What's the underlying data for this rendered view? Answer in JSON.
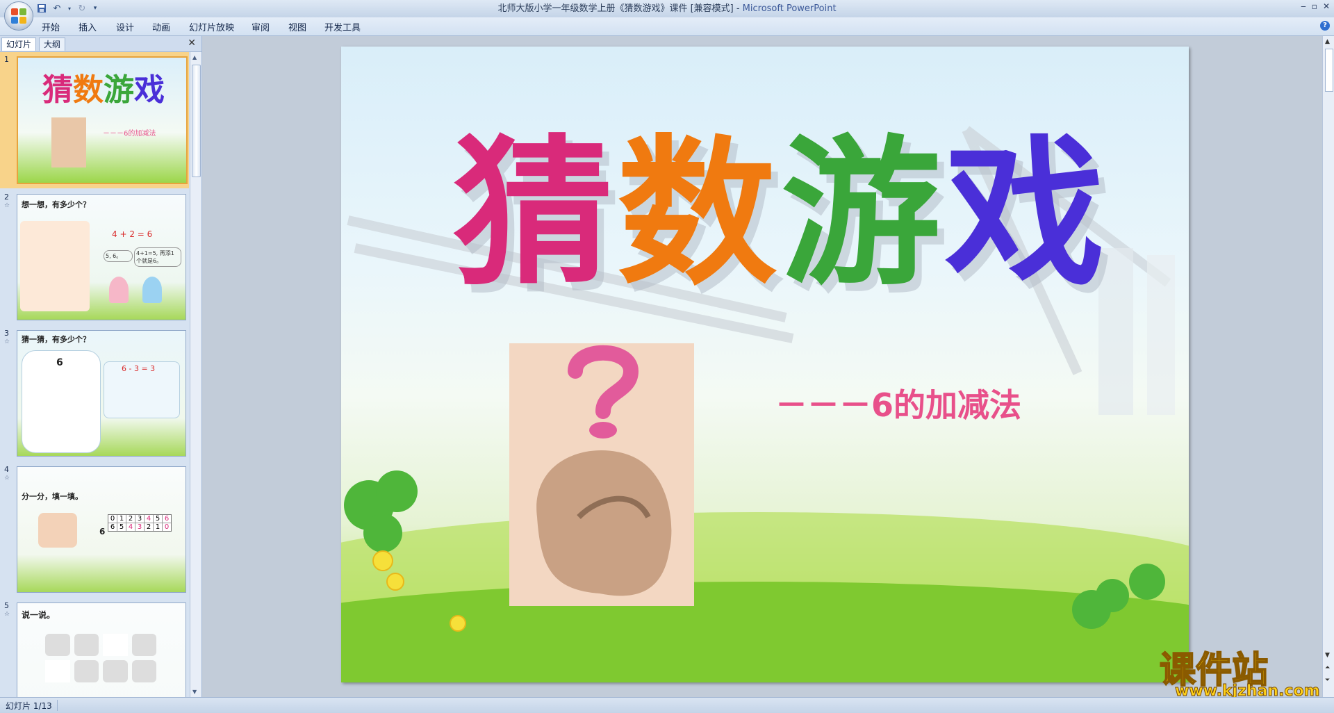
{
  "window": {
    "title": "北师大版小学一年级数学上册《猜数游戏》课件 [兼容模式] - ",
    "app_name": "Microsoft PowerPoint"
  },
  "ribbon": {
    "tabs": [
      "开始",
      "插入",
      "设计",
      "动画",
      "幻灯片放映",
      "审阅",
      "视图",
      "开发工具"
    ]
  },
  "pane": {
    "tabs": [
      "幻灯片",
      "大纲"
    ],
    "close": "✕"
  },
  "thumbnails": [
    {
      "num": "1",
      "title": "猜数游戏",
      "subtitle": "－－－6的加减法"
    },
    {
      "num": "2",
      "title": "想一想，有多少个？",
      "eq": "4 + 2 = 6",
      "bubble1": "5, 6。",
      "bubble2": "4+1=5, 再添1个就是6。"
    },
    {
      "num": "3",
      "title": "猜一猜，有多少个？",
      "count": "6",
      "eq": "6 - 3 = 3"
    },
    {
      "num": "4",
      "title": "分一分，填一填。",
      "lead": "6",
      "row1": [
        "0",
        "1",
        "2",
        "3",
        "4",
        "5",
        "6"
      ],
      "row2": [
        "6",
        "5",
        "4",
        "3",
        "2",
        "1",
        "0"
      ]
    },
    {
      "num": "5",
      "title": "说一说。"
    }
  ],
  "slide": {
    "title_chars": [
      "猜",
      "数",
      "游",
      "戏"
    ],
    "subtitle": "－－－6的加减法"
  },
  "colors": {
    "title_char_1": "#d92a7a",
    "title_char_2": "#f07a10",
    "title_char_3": "#3aa63a",
    "title_char_4": "#4a2fd8",
    "subtitle": "#e8508a"
  },
  "watermark": {
    "text": "课件站",
    "url": "www.kjzhan.com"
  },
  "status": {
    "slide_counter": "幻灯片 1/13"
  }
}
